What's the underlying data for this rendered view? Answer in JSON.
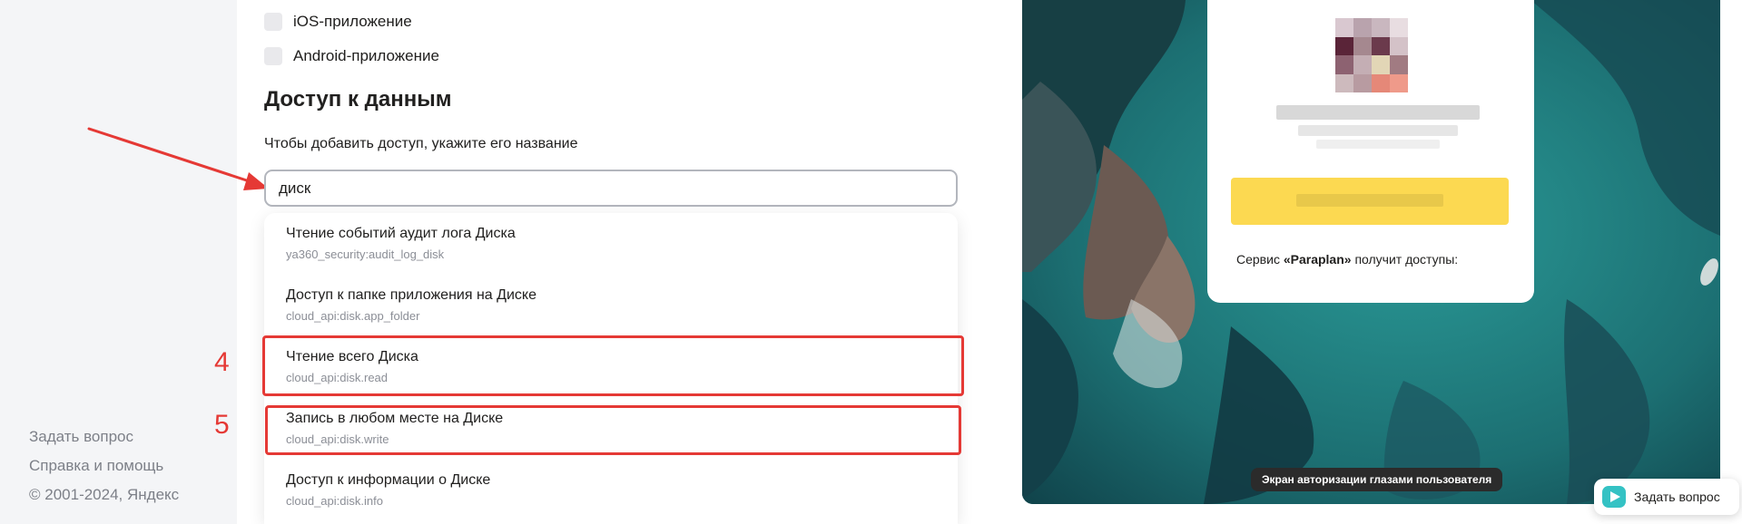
{
  "sidebar": {
    "footer_links": [
      "Задать вопрос",
      "Справка и помощь",
      "© 2001-2024, Яндекс"
    ]
  },
  "platforms": [
    {
      "label": "iOS-приложение",
      "checked": false
    },
    {
      "label": "Android-приложение",
      "checked": false
    }
  ],
  "data_access": {
    "title": "Доступ к данным",
    "hint": "Чтобы добавить доступ, укажите его название",
    "search_value": "диск"
  },
  "suggestions": [
    {
      "title": "Чтение событий аудит лога Диска",
      "scope": "ya360_security:audit_log_disk"
    },
    {
      "title": "Доступ к папке приложения на Диске",
      "scope": "cloud_api:disk.app_folder"
    },
    {
      "title": "Чтение всего Диска",
      "scope": "cloud_api:disk.read"
    },
    {
      "title": "Запись в любом месте на Диске",
      "scope": "cloud_api:disk.write"
    },
    {
      "title": "Доступ к информации о Диске",
      "scope": "cloud_api:disk.info"
    }
  ],
  "annotations": {
    "step_4": "4",
    "step_5": "5",
    "highlight_color": "#e53935"
  },
  "preview": {
    "card_text_prefix": "Сервис ",
    "service_name": "«Paraplan»",
    "card_text_suffix": " получит доступы:",
    "caption": "Экран авторизации глазами пользователя"
  },
  "ask_button": {
    "label": "Задать вопрос",
    "icon": "chat-icon"
  },
  "colors": {
    "accent_red": "#e53935",
    "sidebar_bg": "#f4f5f7",
    "sea": "#1d6b6c"
  }
}
